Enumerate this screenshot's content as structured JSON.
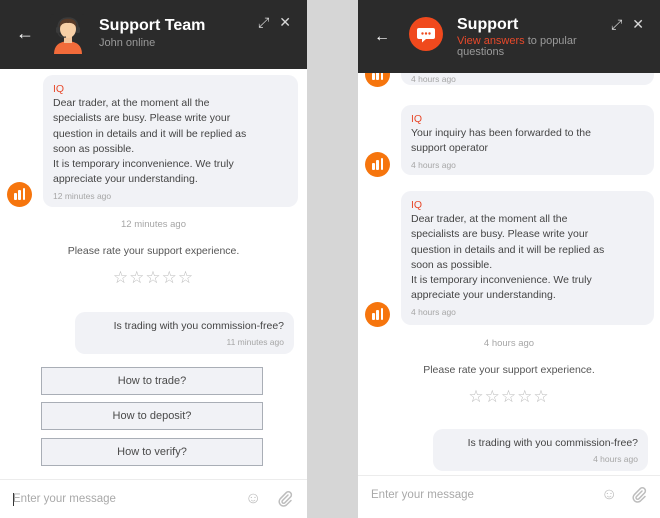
{
  "left": {
    "header": {
      "title": "Support Team",
      "subtitle": "John online"
    },
    "messages": [
      {
        "sender": "IQ",
        "text": "Dear trader, at the moment all the\nspecialists are busy. Please write your\nquestion in details and it will be replied as\nsoon as possible.\nIt is temporary inconvenience. We truly\nappreciate your understanding.",
        "time": "12 minutes ago"
      }
    ],
    "divider_time": "12 minutes ago",
    "rate_prompt": "Please rate your support experience.",
    "user_message": {
      "text": "Is trading with you commission-free?",
      "time": "11 minutes ago"
    },
    "quick_replies": [
      "How to trade?",
      "How to deposit?",
      "How to verify?"
    ],
    "composer": {
      "placeholder": "Enter your message"
    }
  },
  "right": {
    "header": {
      "title": "Support",
      "subtitle_link": "View answers",
      "subtitle_rest": " to popular questions"
    },
    "top_partial_time": "4 hours ago",
    "messages": [
      {
        "sender": "IQ",
        "text": "Your inquiry has been forwarded to the\nsupport operator",
        "time": "4 hours ago"
      },
      {
        "sender": "IQ",
        "text": "Dear trader, at the moment all the\nspecialists are busy. Please write your\nquestion in details and it will be replied as\nsoon as possible.\nIt is temporary inconvenience. We truly\nappreciate your understanding.",
        "time": "4 hours ago"
      }
    ],
    "divider_time": "4 hours ago",
    "rate_prompt": "Please rate your support experience.",
    "user_message": {
      "text": "Is trading with you commission-free?",
      "time": "4 hours ago"
    },
    "composer": {
      "placeholder": "Enter your message"
    }
  },
  "icons": {
    "back": "back-arrow-icon",
    "expand": "expand-icon",
    "close": "close-icon",
    "emoji": "emoji-icon",
    "attach": "paperclip-icon",
    "chat": "chat-bubble-icon",
    "brand": "iq-logo-icon"
  },
  "colors": {
    "header_bg": "#2b2b2b",
    "accent": "#e8492b",
    "brand_orange": "#f6750d",
    "bubble_bg": "#f1f2f6"
  }
}
